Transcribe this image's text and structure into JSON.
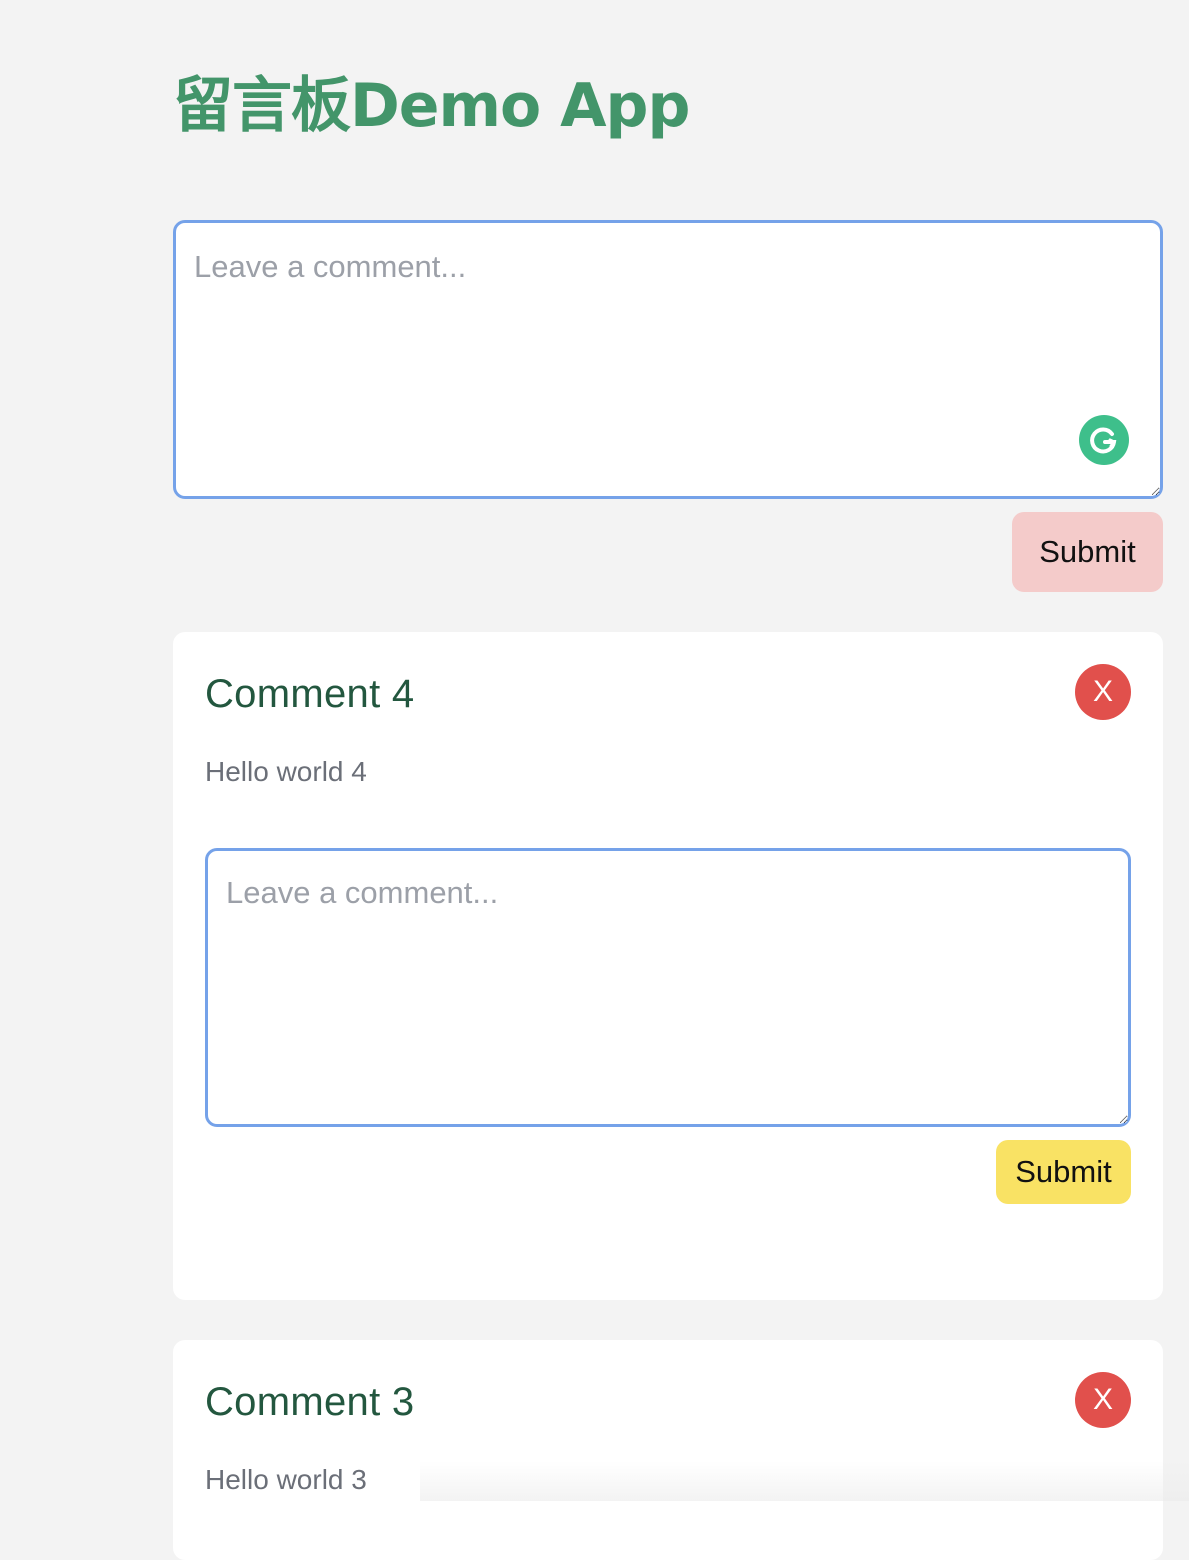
{
  "app": {
    "title": "留言板Demo App"
  },
  "new_comment": {
    "placeholder": "Leave a comment...",
    "value": "",
    "submit_label": "Submit"
  },
  "comments": [
    {
      "title": "Comment 4",
      "body": "Hello world 4",
      "delete_label": "X",
      "reply_placeholder": "Leave a comment...",
      "reply_submit_label": "Submit"
    },
    {
      "title": "Comment 3",
      "body": "Hello world 3",
      "delete_label": "X"
    }
  ],
  "colors": {
    "title": "#43956a",
    "comment_title": "#23573f",
    "main_submit": "#f4cbca",
    "reply_submit": "#f9e264",
    "delete": "#e1504c",
    "textarea_border": "#75a2e9"
  },
  "icons": {
    "grammarly": "grammarly-icon"
  }
}
